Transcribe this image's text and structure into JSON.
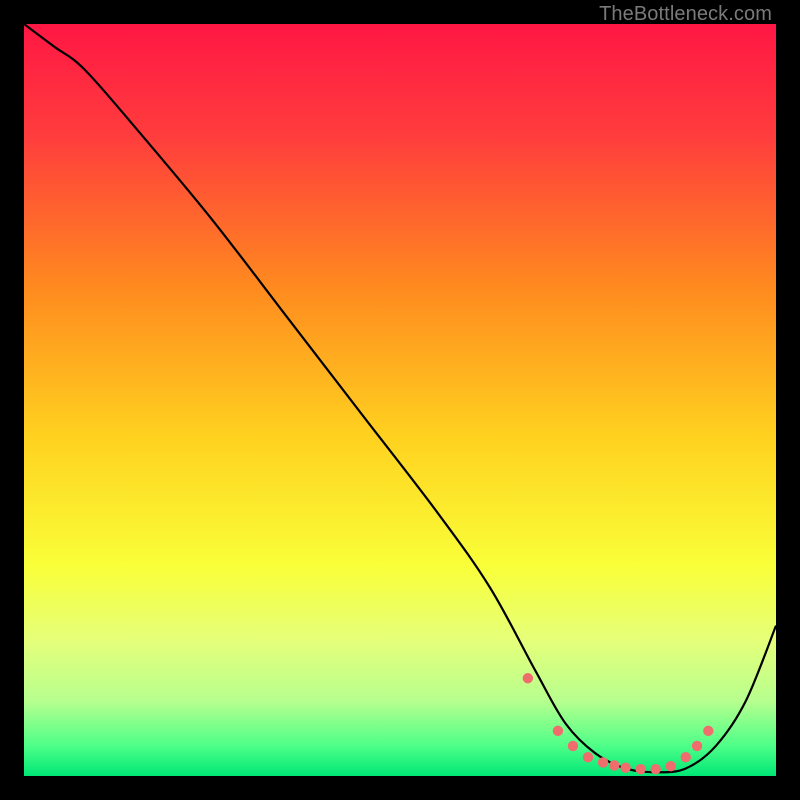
{
  "watermark": "TheBottleneck.com",
  "chart_data": {
    "type": "line",
    "title": "",
    "xlabel": "",
    "ylabel": "",
    "xlim": [
      0,
      100
    ],
    "ylim": [
      0,
      100
    ],
    "grid": false,
    "gradient_stops": [
      {
        "offset": 0,
        "color": "#FF1744"
      },
      {
        "offset": 15,
        "color": "#FF3D3D"
      },
      {
        "offset": 35,
        "color": "#FF8A1F"
      },
      {
        "offset": 55,
        "color": "#FFD21F"
      },
      {
        "offset": 72,
        "color": "#F9FF38"
      },
      {
        "offset": 82,
        "color": "#E5FF7A"
      },
      {
        "offset": 90,
        "color": "#B7FF8E"
      },
      {
        "offset": 96,
        "color": "#4DFF88"
      },
      {
        "offset": 100,
        "color": "#00E676"
      }
    ],
    "series": [
      {
        "name": "curve",
        "x": [
          0,
          4,
          8,
          15,
          25,
          35,
          45,
          55,
          62,
          68,
          72,
          76,
          80,
          84,
          88,
          92,
          96,
          100
        ],
        "y": [
          100,
          97,
          94,
          86,
          74,
          61,
          48,
          35,
          25,
          14,
          7,
          3,
          1,
          0.5,
          1,
          4,
          10,
          20
        ]
      }
    ],
    "markers": {
      "name": "highlight-points",
      "color": "#F06D6D",
      "x": [
        67,
        71,
        73,
        75,
        77,
        78.5,
        80,
        82,
        84,
        86,
        88,
        89.5,
        91
      ],
      "y": [
        13,
        6,
        4,
        2.5,
        1.8,
        1.4,
        1.1,
        0.9,
        0.9,
        1.3,
        2.5,
        4,
        6
      ]
    }
  }
}
